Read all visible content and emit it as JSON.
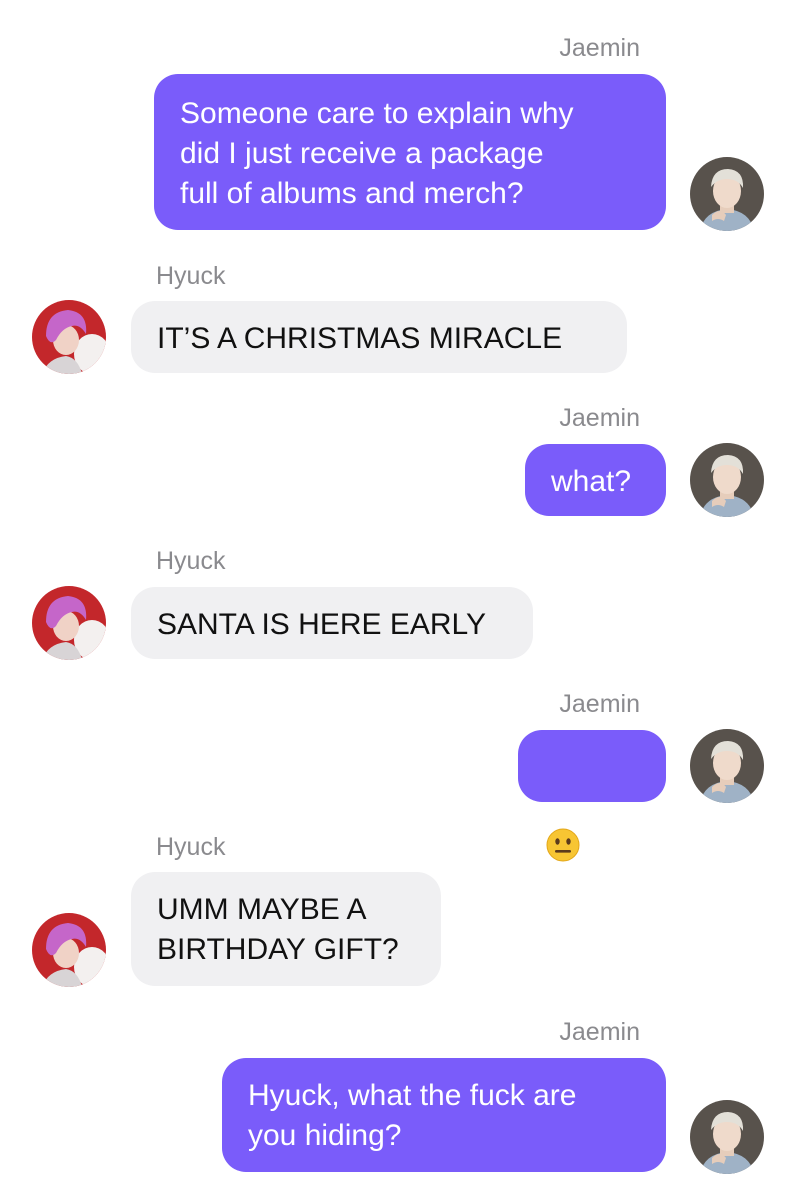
{
  "messages": [
    {
      "sender": "Jaemin",
      "side": "right",
      "text": "Someone care to explain why\ndid I just receive a package\nfull of albums and merch?"
    },
    {
      "sender": "Hyuck",
      "side": "left",
      "text": "IT’S A CHRISTMAS MIRACLE"
    },
    {
      "sender": "Jaemin",
      "side": "right",
      "text": "what?"
    },
    {
      "sender": "Hyuck",
      "side": "left",
      "text": "SANTA IS HERE EARLY"
    },
    {
      "sender": "Jaemin",
      "side": "right",
      "emoji": "neutral-face-emoji",
      "text": "???"
    },
    {
      "sender": "Hyuck",
      "side": "left",
      "text": "UMM MAYBE A\nBIRTHDAY GIFT?"
    },
    {
      "sender": "Jaemin",
      "side": "right",
      "text": "Hyuck, what the fuck are\nyou hiding?"
    }
  ],
  "colors": {
    "sent_bubble": "#7a5cfa",
    "received_bubble": "#f0f0f2",
    "sender_name": "#8a8a8e"
  }
}
